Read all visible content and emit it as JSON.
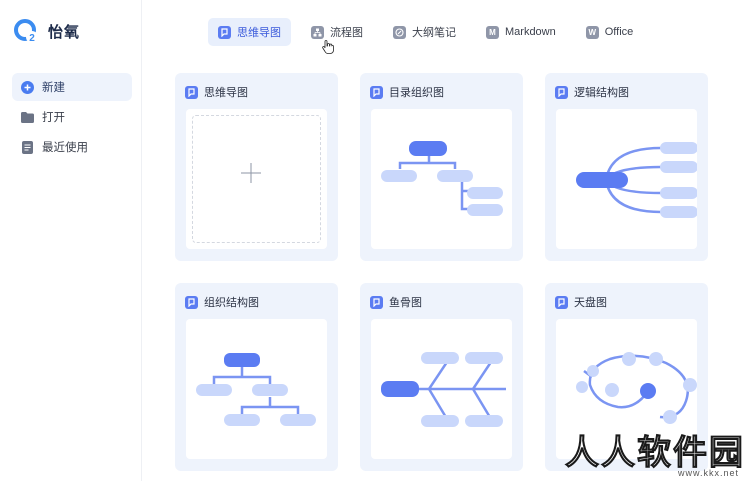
{
  "app": {
    "name": "怡氧"
  },
  "sidebar": {
    "items": [
      {
        "label": "新建",
        "icon": "plus-circle-icon",
        "active": true
      },
      {
        "label": "打开",
        "icon": "folder-icon",
        "active": false
      },
      {
        "label": "最近使用",
        "icon": "document-icon",
        "active": false
      }
    ]
  },
  "tabs": [
    {
      "label": "思维导图",
      "icon": "mindmap-icon",
      "active": true
    },
    {
      "label": "流程图",
      "icon": "flowchart-icon",
      "active": false
    },
    {
      "label": "大纲笔记",
      "icon": "outline-icon",
      "active": false
    },
    {
      "label": "Markdown",
      "icon": "markdown-icon",
      "badge": "M",
      "active": false
    },
    {
      "label": "Office",
      "icon": "office-icon",
      "badge": "W",
      "active": false
    }
  ],
  "templates": [
    {
      "title": "思维导图",
      "kind": "blank"
    },
    {
      "title": "目录组织图",
      "kind": "directory"
    },
    {
      "title": "逻辑结构图",
      "kind": "logic"
    },
    {
      "title": "组织结构图",
      "kind": "org"
    },
    {
      "title": "鱼骨图",
      "kind": "fishbone"
    },
    {
      "title": "天盘图",
      "kind": "sky"
    }
  ],
  "watermark": {
    "text": "人人软件园",
    "url": "www.kkx.net"
  },
  "colors": {
    "accent": "#5b7cf2",
    "accent_light": "#c9d7fb",
    "card_bg": "#eef3fc",
    "line": "#7b95f2"
  }
}
